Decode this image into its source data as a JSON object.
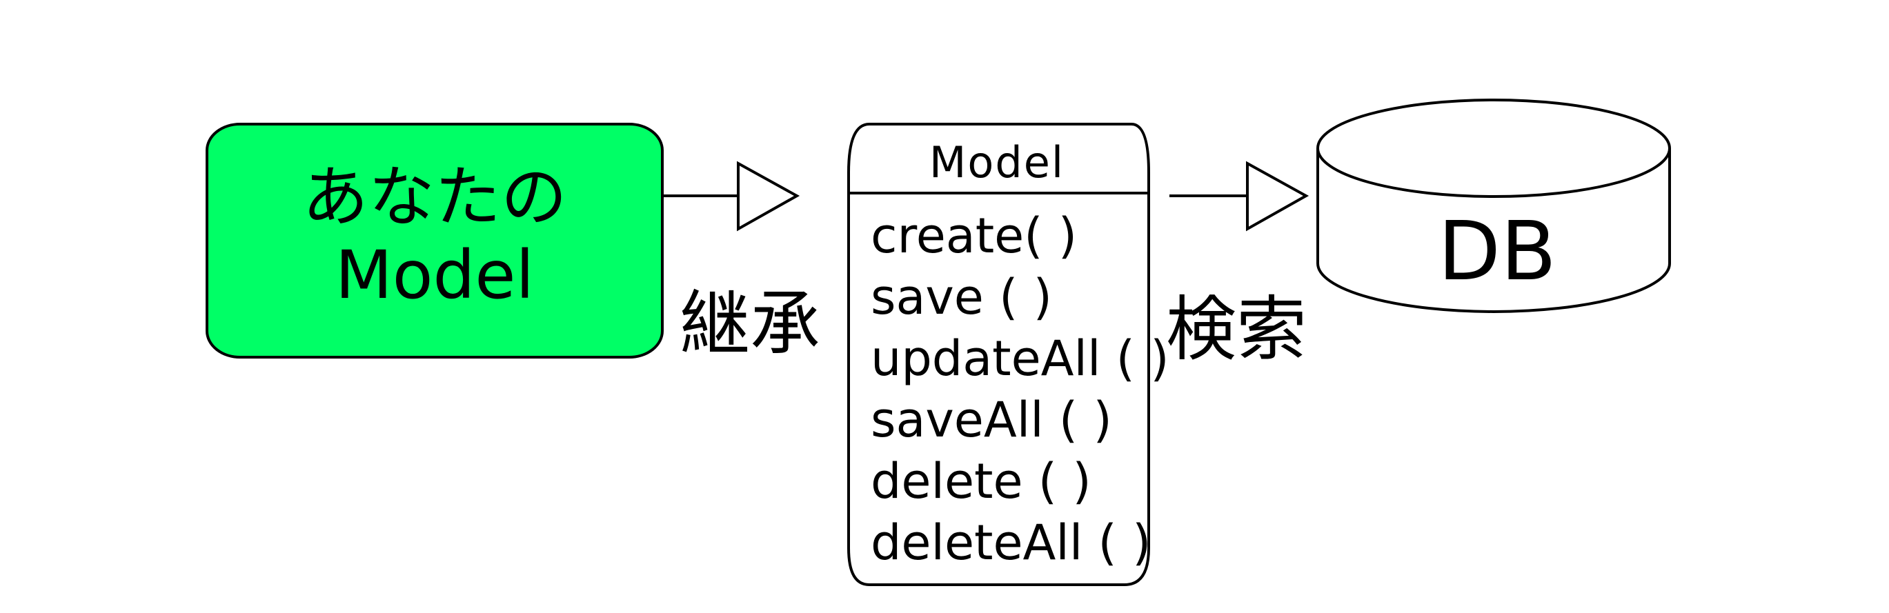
{
  "your_model": {
    "line1": "あなたの",
    "line2": "Model",
    "fill_color": "#00ff66"
  },
  "inheritance_label": "継承",
  "base_class": {
    "title": "Model",
    "methods": [
      "create( )",
      "save ( )",
      "updateAll ( )",
      "saveAll ( )",
      "delete ( )",
      "deleteAll ( )"
    ]
  },
  "search_label": "検索",
  "database": {
    "label": "DB"
  }
}
